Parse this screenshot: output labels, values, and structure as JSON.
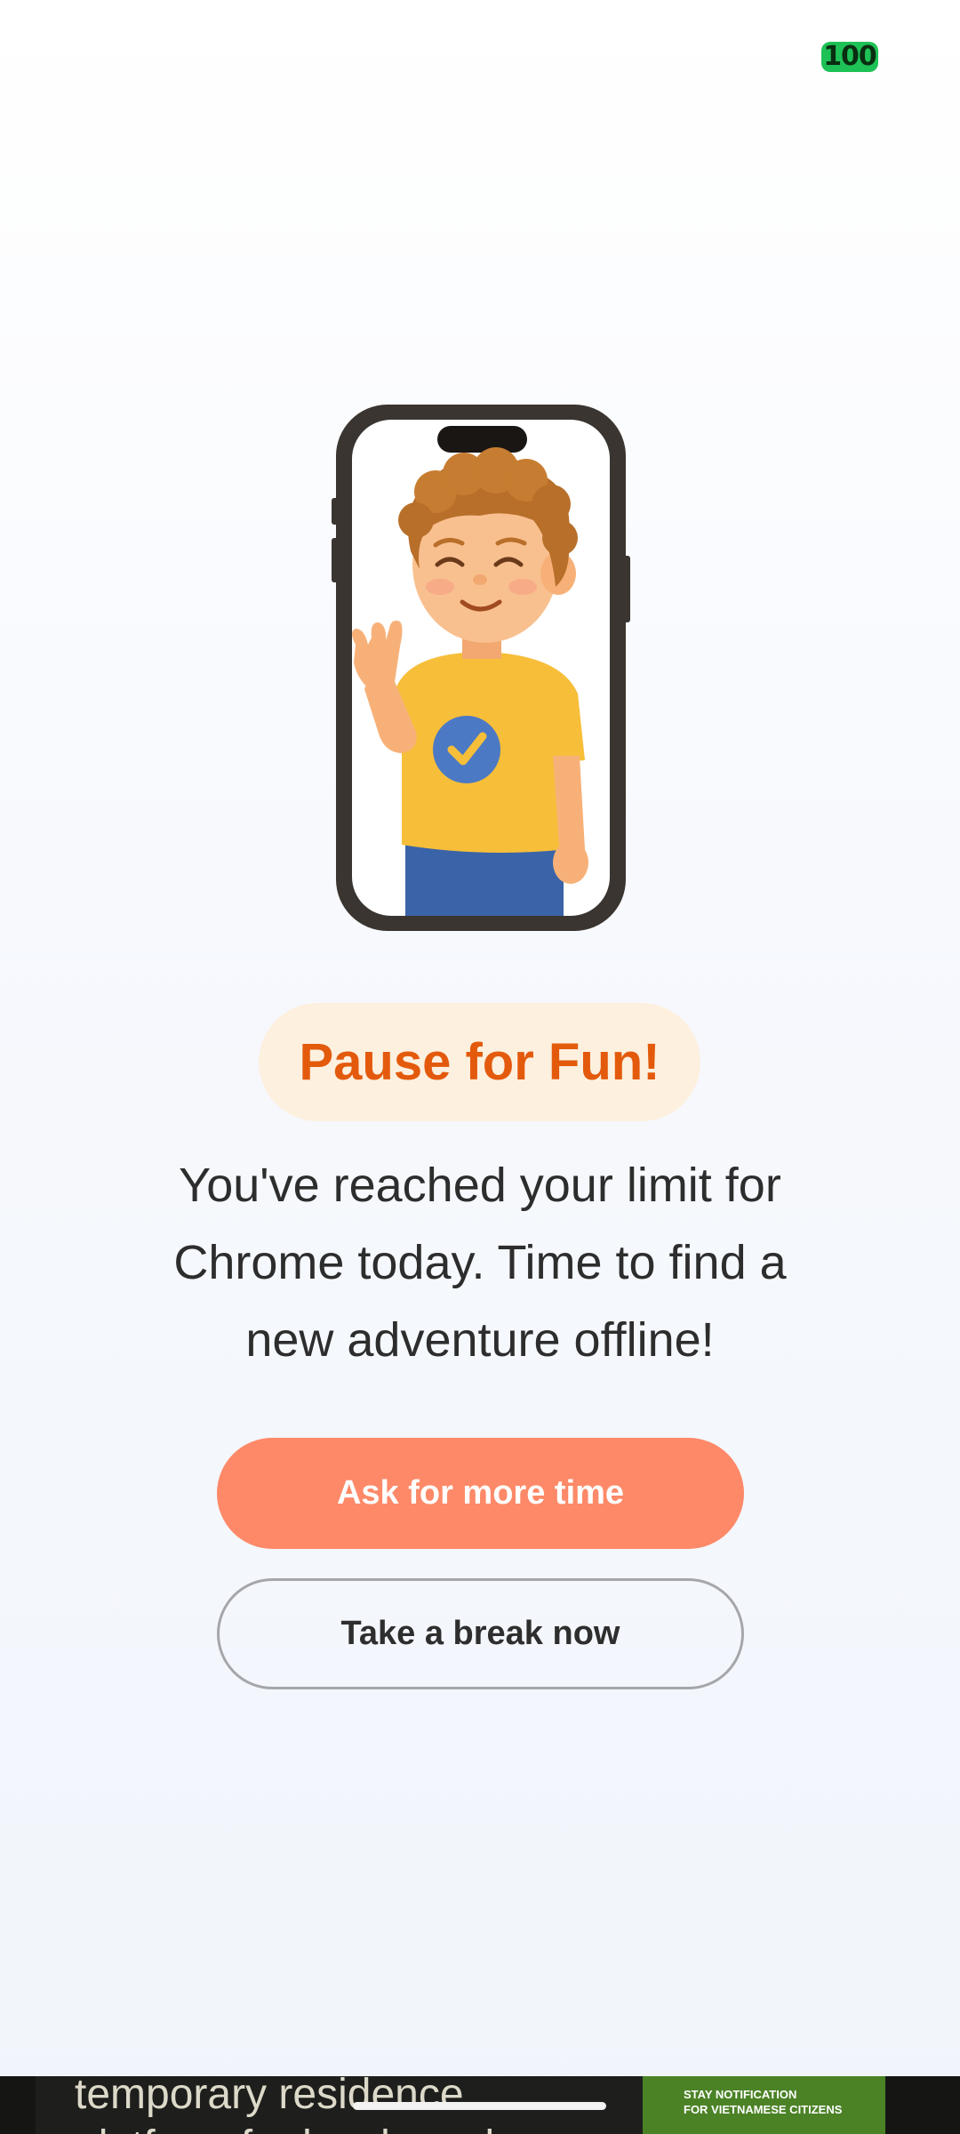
{
  "status_bar": {
    "battery": "100"
  },
  "illustration": {
    "description_icon": "waving-boy-in-phone-illustration"
  },
  "title": "Pause for Fun!",
  "message": "You've reached your limit for\nChrome today. Time to find a\nnew adventure offline!",
  "buttons": {
    "primary": "Ask for more time",
    "secondary": "Take a break now"
  },
  "ad": {
    "text": "temporary residence\nplatform for locals and",
    "badge": "STAY NOTIFICATION\nFOR VIETNAMESE CITIZENS"
  },
  "colors": {
    "title_text": "#e35a0c",
    "title_pill": "#fdf0df",
    "primary_button": "#fe8968",
    "battery": "#1ec155"
  }
}
